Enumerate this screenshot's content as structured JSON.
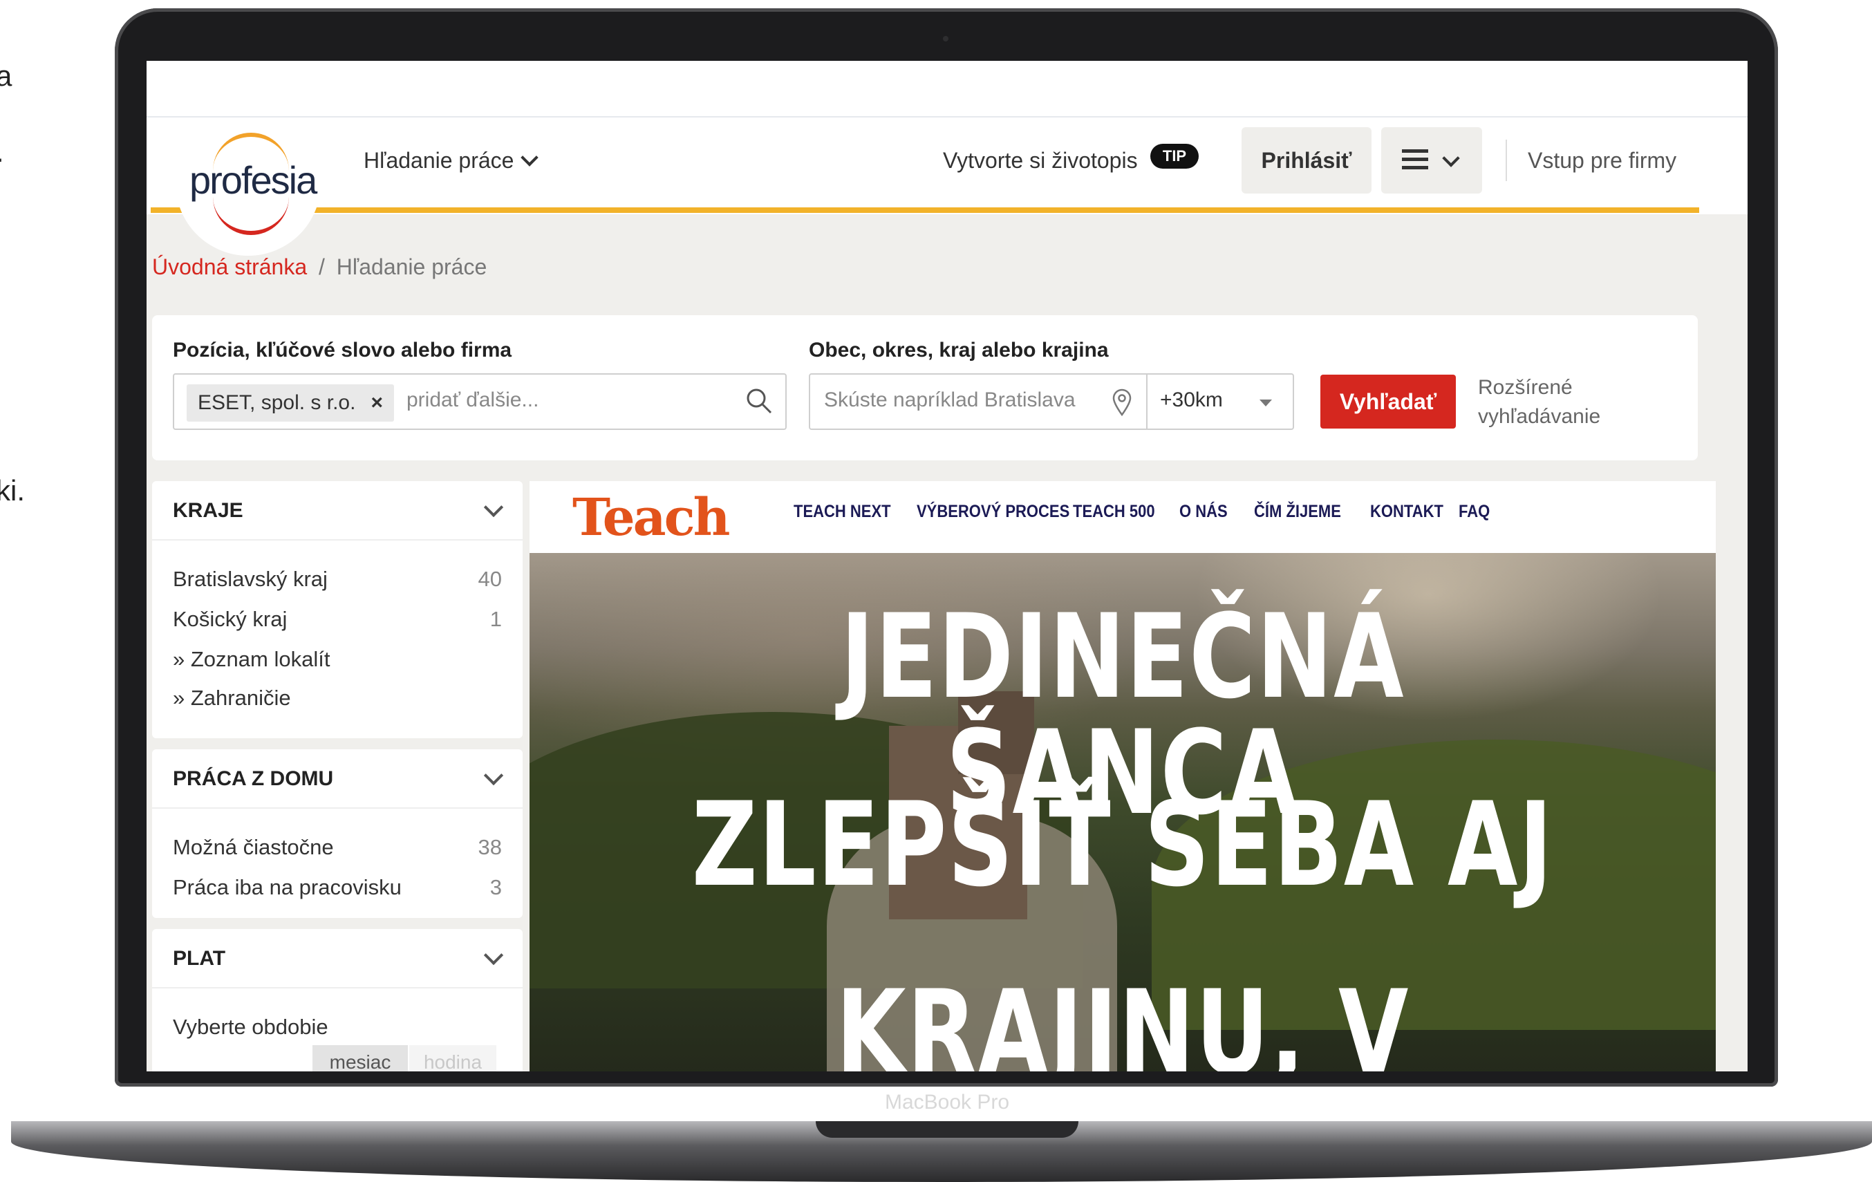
{
  "edge_fragments": [
    "a",
    ".",
    "ki."
  ],
  "device": {
    "label": "MacBook Pro"
  },
  "header": {
    "logo_text": "profesia",
    "job_search_label": "Hľadanie práce",
    "cv_label": "Vytvorte si životopis",
    "tip_badge": "TIP",
    "login_label": "Prihlásiť",
    "employers_label": "Vstup pre firmy"
  },
  "breadcrumb": {
    "home": "Úvodná stránka",
    "separator": "/",
    "current": "Hľadanie práce"
  },
  "search": {
    "position_label": "Pozícia, kľúčové slovo alebo firma",
    "chip_value": "ESET, spol. s r.o.",
    "chip_remove": "×",
    "position_placeholder": "pridať ďalšie...",
    "location_label": "Obec, okres, kraj alebo krajina",
    "location_placeholder": "Skúste napríklad Bratislava",
    "radius_value": "+30km",
    "submit_label": "Vyhľadať",
    "advanced_line1": "Rozšírené",
    "advanced_line2": "vyhľadávanie"
  },
  "filters": {
    "regions": {
      "title": "KRAJE",
      "items": [
        {
          "label": "Bratislavský kraj",
          "count": "40"
        },
        {
          "label": "Košický kraj",
          "count": "1"
        },
        {
          "label": "» Zoznam lokalít",
          "count": ""
        },
        {
          "label": "» Zahraničie",
          "count": ""
        }
      ]
    },
    "remote": {
      "title": "PRÁCA Z DOMU",
      "items": [
        {
          "label": "Možná čiastočne",
          "count": "38"
        },
        {
          "label": "Práca iba na pracovisku",
          "count": "3"
        }
      ]
    },
    "salary": {
      "title": "PLAT",
      "period_label": "Vyberte obdobie",
      "period_options": [
        "mesiac",
        "hodina"
      ]
    }
  },
  "banner": {
    "logo": "Teach",
    "nav": [
      "TEACH NEXT",
      "VÝBEROVÝ PROCES",
      "TEACH 500",
      "O NÁS",
      "ČÍM ŽIJEME",
      "KONTAKT",
      "FAQ"
    ],
    "headline": [
      "JEDINEČNÁ ŠANCA",
      "ZLEPŠIŤ SEBA AJ",
      "KRAJINU, V KTOREJ"
    ]
  },
  "colors": {
    "brand_red": "#d5271f",
    "brand_yellow": "#f2b22a",
    "teach_orange": "#e2531b",
    "teach_navy": "#1b1a55"
  },
  "icons": [
    "chevron-down-icon",
    "menu-icon",
    "search-icon",
    "location-pin-icon",
    "caret-down-icon"
  ]
}
